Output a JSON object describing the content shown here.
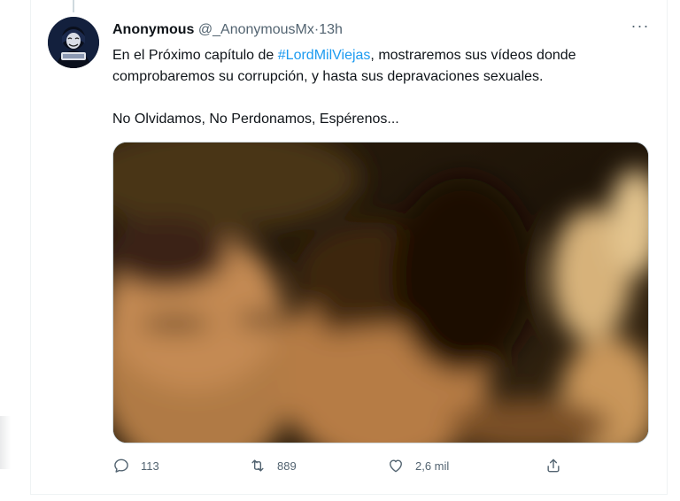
{
  "tweet": {
    "author_name": "Anonymous",
    "handle": "@_AnonymousMx",
    "separator": "·",
    "time": "13h",
    "more_label": "···",
    "text_line1_before": "En el Próximo capítulo de ",
    "hashtag": "#LordMilViejas",
    "text_line1_after": ", mostraremos sus vídeos donde",
    "text_line2": "comprobaremos su corrupción, y hasta sus depravaciones sexuales.",
    "text_line3": "No Olvidamos, No Perdonamos, Espérenos..."
  },
  "actions": {
    "replies": "113",
    "retweets": "889",
    "likes": "2,6 mil"
  },
  "icons": {
    "reply": "reply-icon",
    "retweet": "retweet-icon",
    "like": "heart-icon",
    "share": "share-icon",
    "more": "more-icon"
  },
  "colors": {
    "link": "#1d9bf0",
    "text": "#0f1419",
    "muted": "#536471"
  }
}
